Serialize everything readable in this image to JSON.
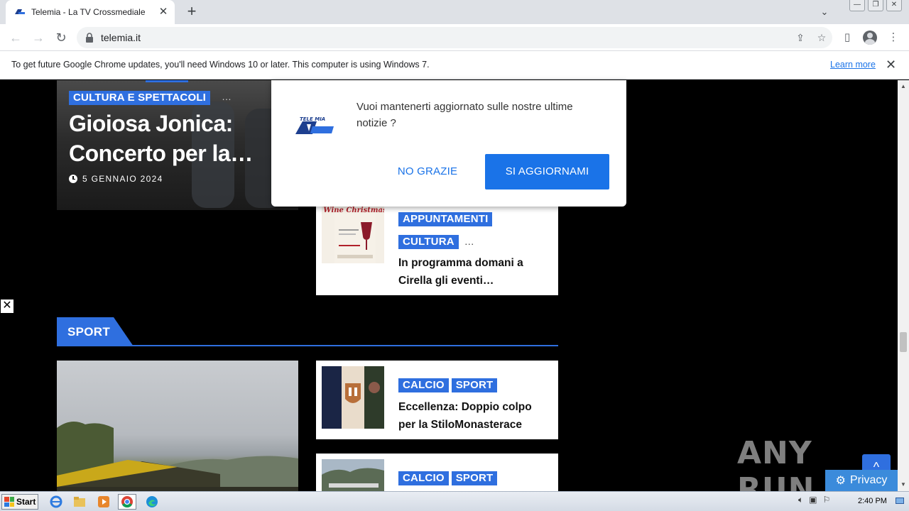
{
  "browser": {
    "tab_title": "Telemia - La TV Crossmediale",
    "url": "telemia.it",
    "infobar_text": "To get future Google Chrome updates, you'll need Windows 10 or later. This computer is using Windows 7.",
    "infobar_link": "Learn more"
  },
  "hero": {
    "category": "CULTURA E SPETTACOLI",
    "more": "…",
    "title": "Gioiosa Jonica: Concerto per la…",
    "date": "5 GENNAIO 2024"
  },
  "cards": [
    {
      "categories": [
        "APPUNTAMENTI",
        "CULTURA"
      ],
      "more": "…",
      "title": "In programma domani a Cirella gli eventi…",
      "thumb_text": "Wine Christmas"
    },
    {
      "categories": [
        "CALCIO",
        "SPORT"
      ],
      "title": "Eccellenza: Doppio colpo per la StiloMonasterace"
    },
    {
      "categories": [
        "CALCIO",
        "SPORT"
      ],
      "title": ""
    }
  ],
  "section": {
    "label": "SPORT"
  },
  "modal": {
    "logo_text": "TELE MIA",
    "message": "Vuoi mantenerti aggiornato sulle nostre ultime notizie ?",
    "no_label": "NO GRAZIE",
    "yes_label": "SI AGGIORNAMI"
  },
  "overlay": {
    "close": "✕",
    "watermark": "ANY RUN",
    "privacy": "Privacy",
    "back_top": "^"
  },
  "taskbar": {
    "start": "Start",
    "time": "2:40 PM"
  },
  "colors": {
    "accent": "#2f6fdf",
    "modal_button": "#1a73e8"
  }
}
